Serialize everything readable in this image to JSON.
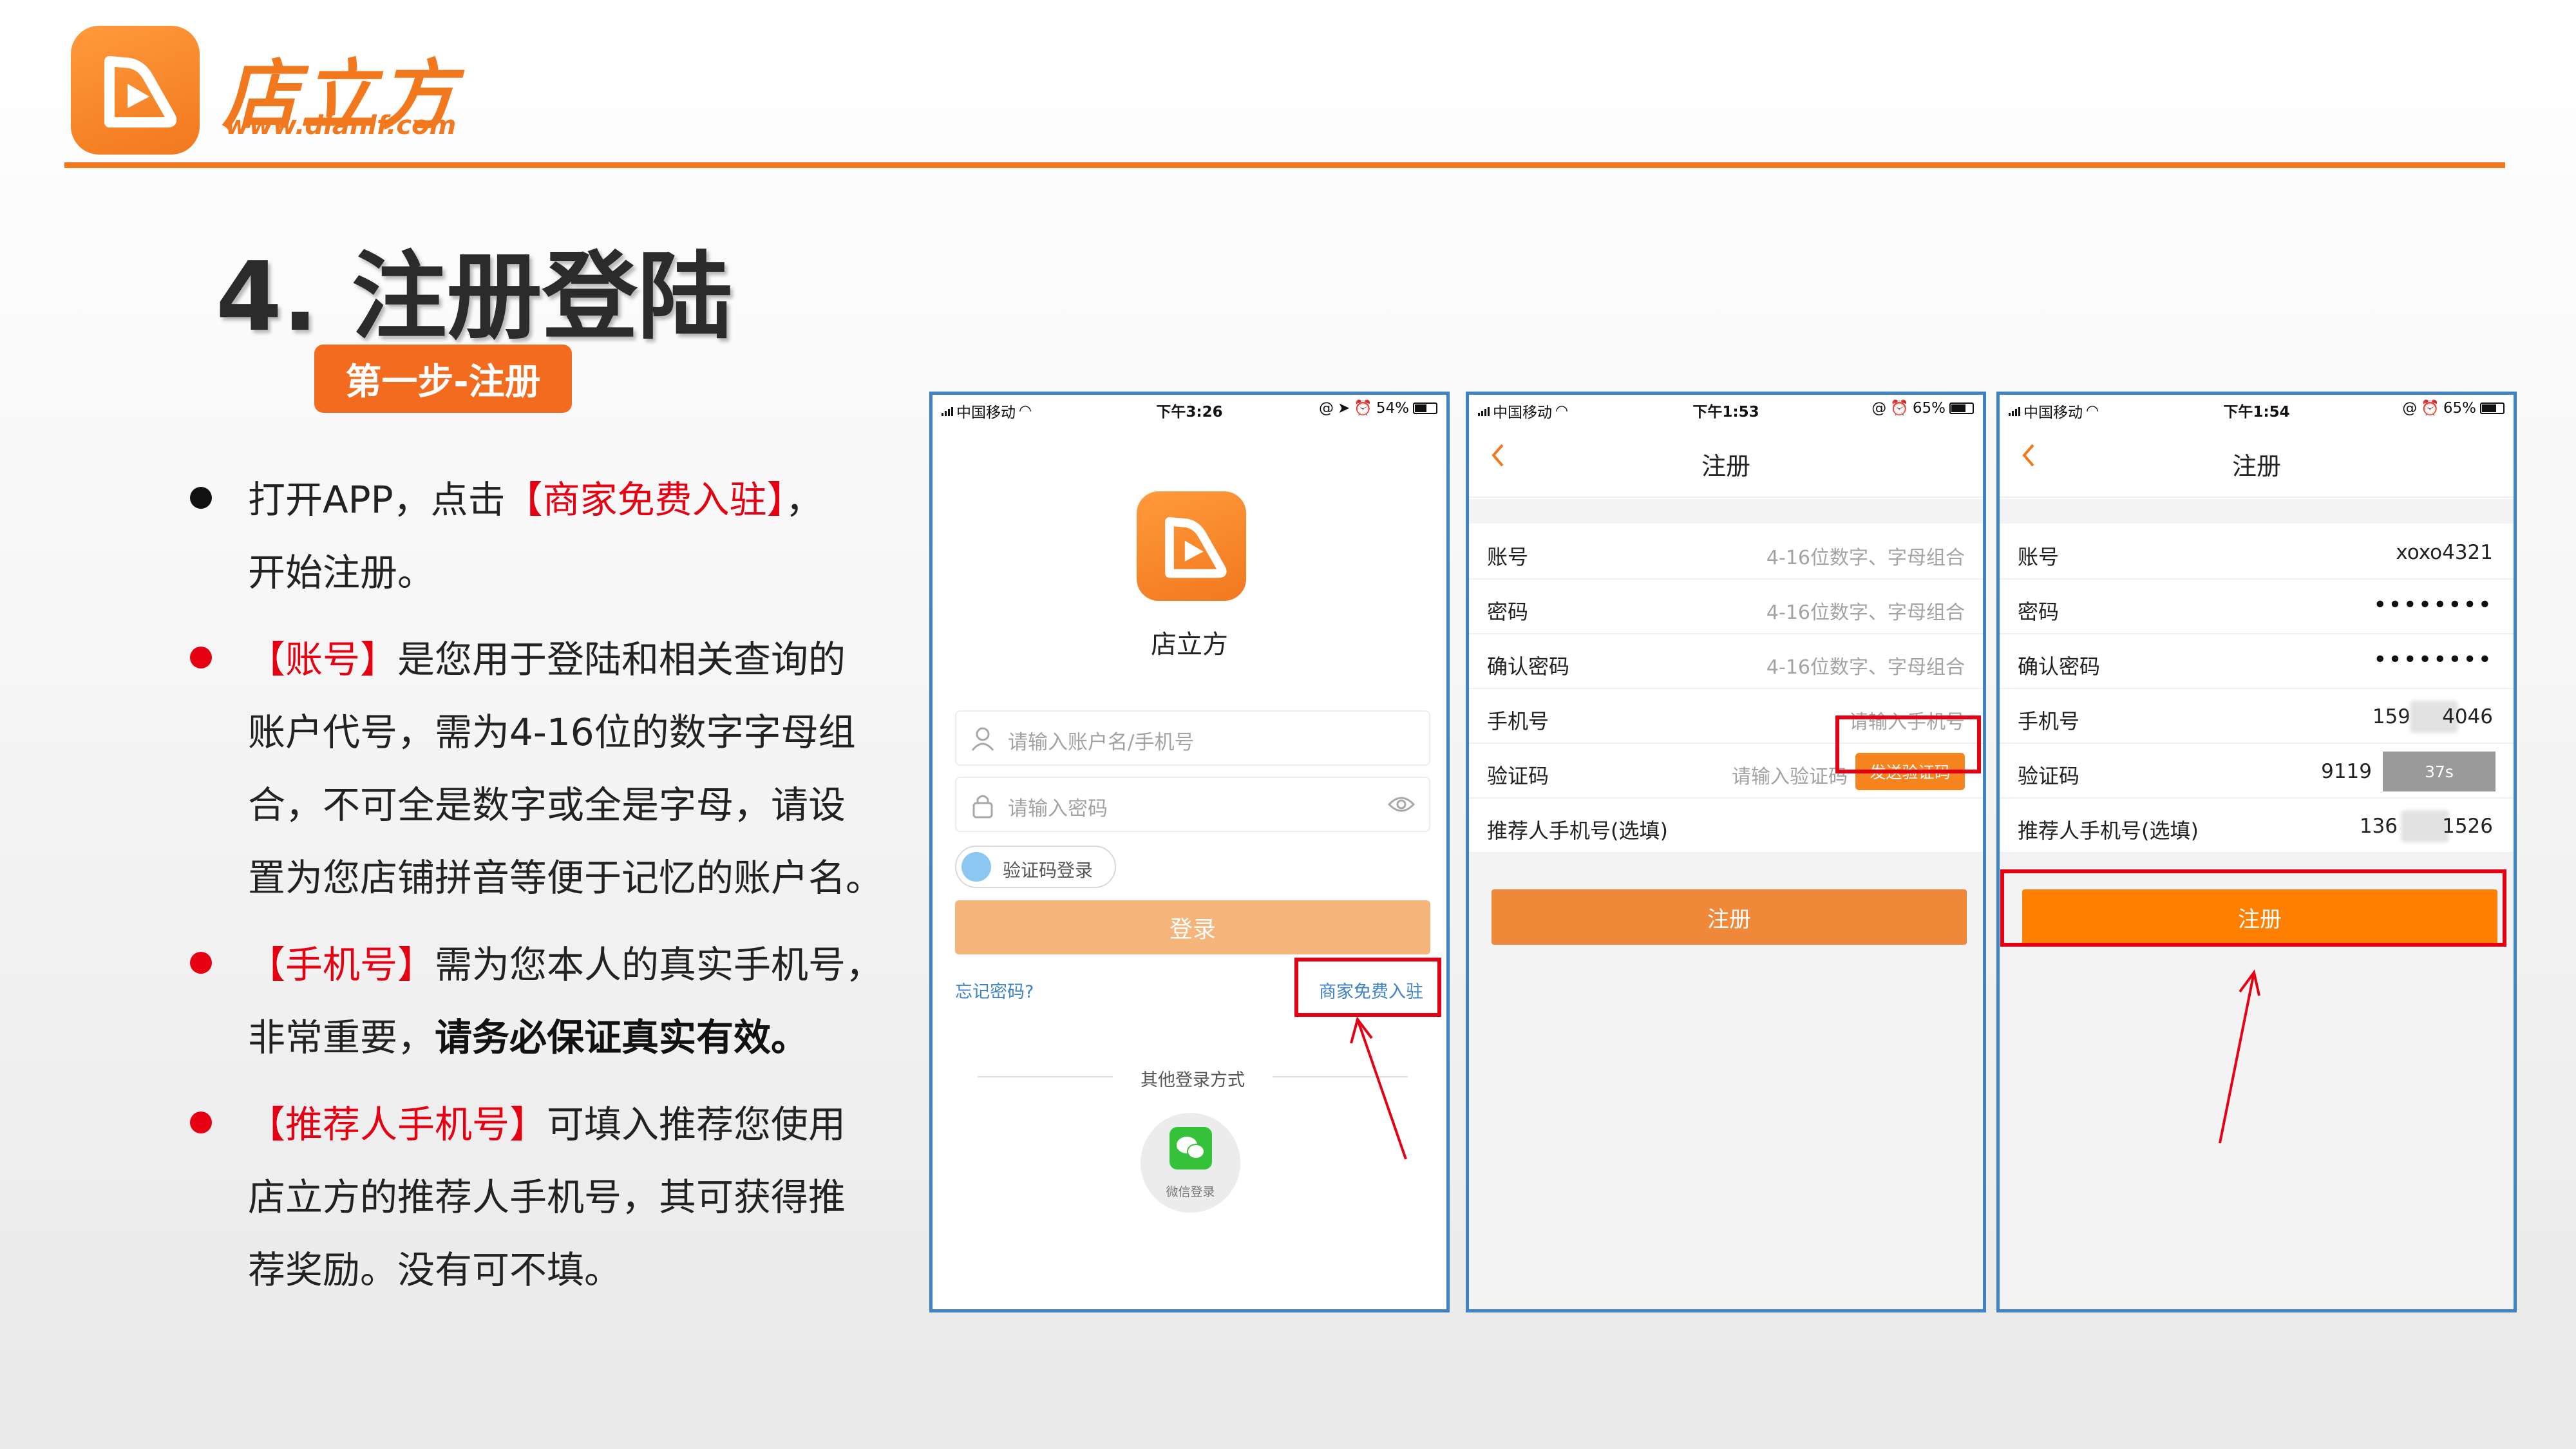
{
  "brand": {
    "name": "店立方",
    "url": "www.dianlf.com",
    "accent_color": "#f2781e"
  },
  "page": {
    "title": "4. 注册登陆",
    "step_badge": "第一步-注册"
  },
  "bullets": [
    {
      "dot": "black",
      "lines": [
        [
          "打开APP，点击",
          "【商家免费入驻】",
          "，"
        ],
        [
          "开始注册。"
        ]
      ]
    },
    {
      "dot": "red",
      "parts": {
        "highlight": "【账号】",
        "l1": "是您用于登陆和相关查询的",
        "l2": "账户代号，需为4-16位的数字字母组",
        "l3": "合，不可全是数字或全是字母，请设",
        "l4": "置为您店铺拼音等便于记忆的账户名。"
      }
    },
    {
      "dot": "red",
      "parts": {
        "highlight": "【手机号】",
        "l1": "需为您本人的真实手机号，",
        "l2a": "非常重要，",
        "l2b": "请务必保证真实有效。"
      }
    },
    {
      "dot": "red",
      "parts": {
        "highlight": "【推荐人手机号】",
        "l1": "可填入推荐您使用",
        "l2": "店立方的推荐人手机号，其可获得推",
        "l3": "荐奖励。没有可不填。"
      }
    }
  ],
  "bullet_text": {
    "b1_a": "打开APP，点击",
    "b1_red": "【商家免费入驻】",
    "b1_b": "，",
    "b1_l2": "开始注册。"
  },
  "phone1": {
    "status": {
      "carrier": "中国移动",
      "time": "下午3:26",
      "battery": "54%"
    },
    "app_name": "店立方",
    "account_placeholder": "请输入账户名/手机号",
    "password_placeholder": "请输入密码",
    "sms_login_toggle": "验证码登录",
    "login_button": "登录",
    "forgot_password": "忘记密码?",
    "merchant_register": "商家免费入驻",
    "other_login": "其他登录方式",
    "wechat_login": "微信登录"
  },
  "phone2": {
    "status": {
      "carrier": "中国移动",
      "time": "下午1:53",
      "battery": "65%"
    },
    "nav_title": "注册",
    "rows": [
      {
        "label": "账号",
        "placeholder": "4-16位数字、字母组合"
      },
      {
        "label": "密码",
        "placeholder": "4-16位数字、字母组合"
      },
      {
        "label": "确认密码",
        "placeholder": "4-16位数字、字母组合"
      },
      {
        "label": "手机号",
        "placeholder": "请输入手机号"
      },
      {
        "label": "验证码",
        "placeholder": "请输入验证码"
      },
      {
        "label": "推荐人手机号(选填)"
      }
    ],
    "send_code_button": "发送验证码",
    "submit_button": "注册"
  },
  "phone3": {
    "status": {
      "carrier": "中国移动",
      "time": "下午1:54",
      "battery": "65%"
    },
    "nav_title": "注册",
    "rows": [
      {
        "label": "账号",
        "value": "xoxo4321"
      },
      {
        "label": "密码",
        "value": "••••••••"
      },
      {
        "label": "确认密码",
        "value": "••••••••"
      },
      {
        "label": "手机号",
        "value_a": "159",
        "value_b": "4046"
      },
      {
        "label": "验证码",
        "value": "9119"
      },
      {
        "label": "推荐人手机号(选填)",
        "value_a": "136",
        "value_b": "1526"
      }
    ],
    "countdown": "37s",
    "submit_button": "注册"
  },
  "icons": {
    "logo": "play-d-logo-icon",
    "user": "user-icon",
    "lock": "lock-icon",
    "eye": "eye-icon",
    "back": "chevron-left-icon",
    "wechat": "wechat-icon",
    "wifi": "wifi-icon"
  }
}
